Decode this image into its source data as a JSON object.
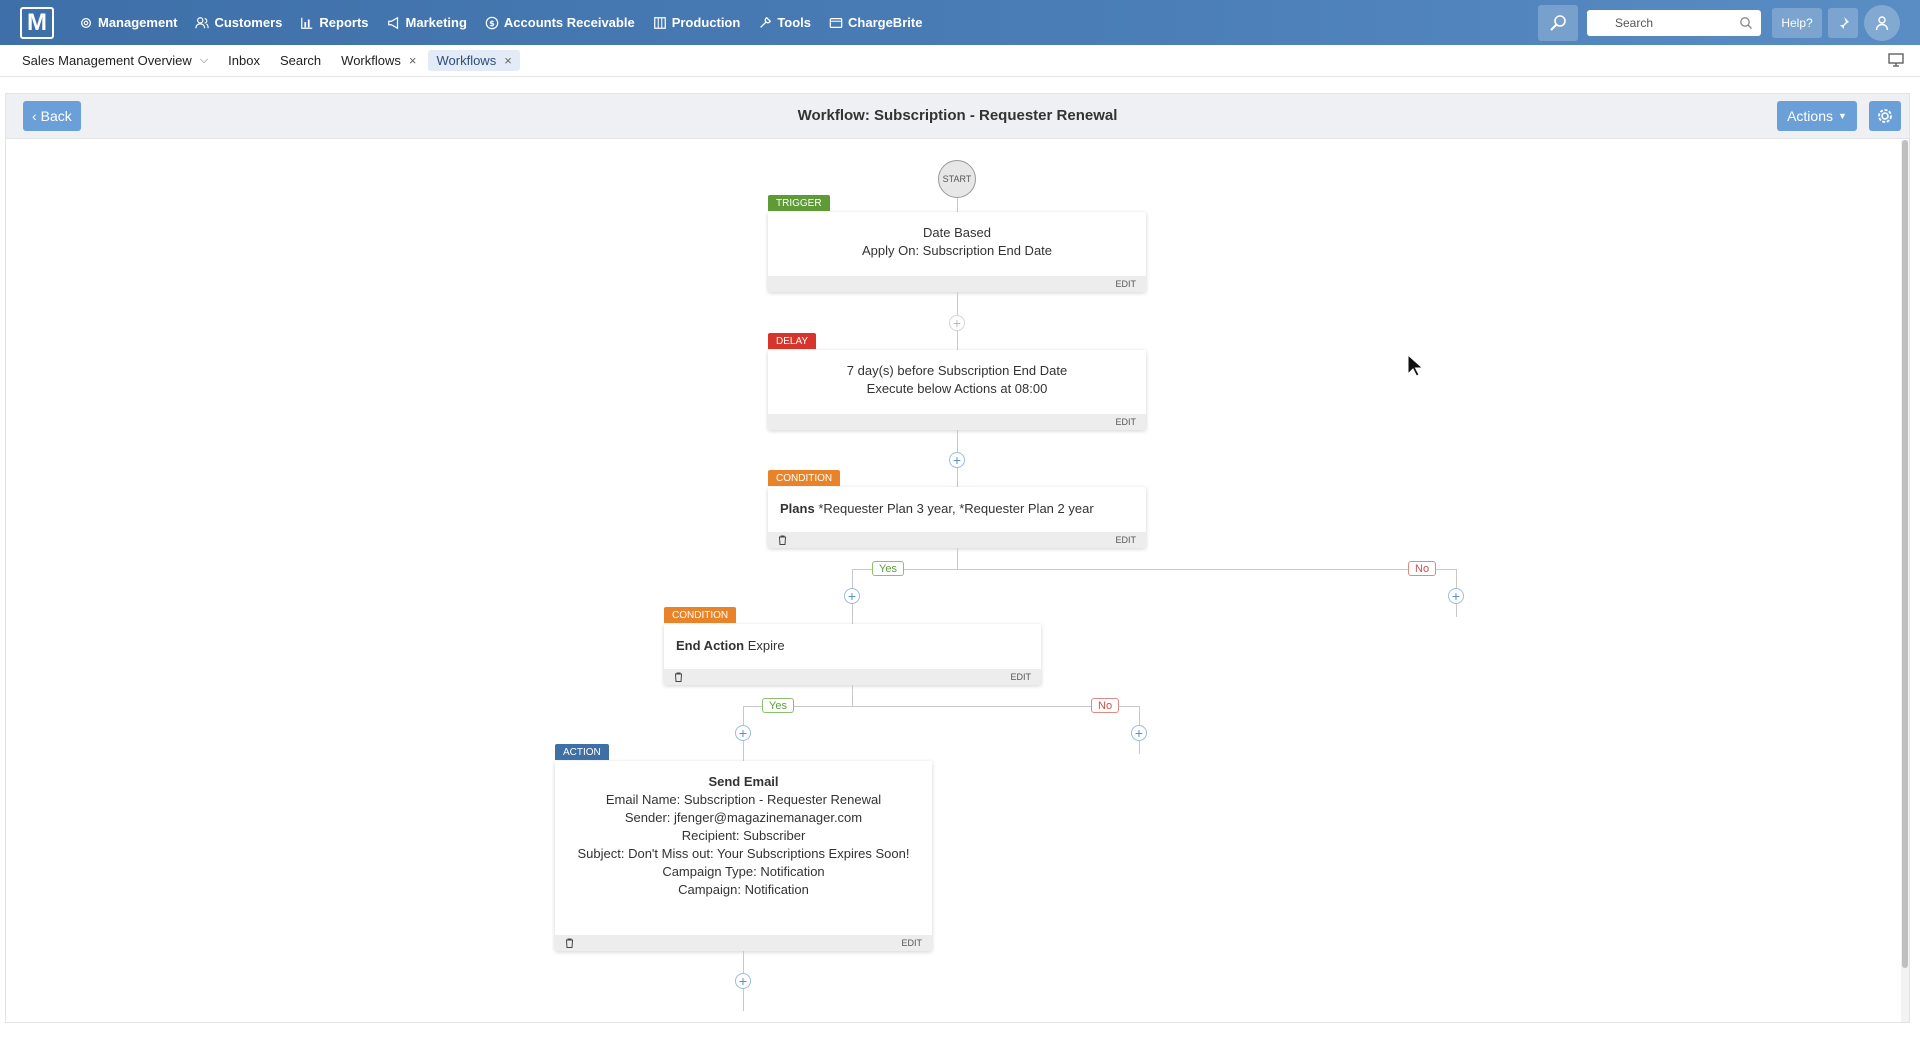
{
  "nav": {
    "logo": "M",
    "items": [
      {
        "label": "Management",
        "icon": "gear-icon"
      },
      {
        "label": "Customers",
        "icon": "users-icon"
      },
      {
        "label": "Reports",
        "icon": "bar-chart-icon"
      },
      {
        "label": "Marketing",
        "icon": "megaphone-icon"
      },
      {
        "label": "Accounts Receivable",
        "icon": "dollar-icon"
      },
      {
        "label": "Production",
        "icon": "columns-icon"
      },
      {
        "label": "Tools",
        "icon": "wrench-icon"
      },
      {
        "label": "ChargeBrite",
        "icon": "card-icon"
      }
    ],
    "search_placeholder": "Search",
    "help_label": "Help?"
  },
  "tabs": [
    {
      "label": "Sales Management Overview",
      "active": false
    },
    {
      "label": "Inbox",
      "active": false
    },
    {
      "label": "Search",
      "active": false
    },
    {
      "label": "Workflows",
      "active": false
    },
    {
      "label": "Workflows",
      "active": true
    }
  ],
  "header": {
    "back_label": "Back",
    "title": "Workflow: Subscription - Requester Renewal",
    "actions_label": "Actions"
  },
  "flow": {
    "start_label": "START",
    "trigger": {
      "tag": "TRIGGER",
      "line1": "Date Based",
      "line2": "Apply On: Subscription End Date",
      "edit": "EDIT"
    },
    "delay": {
      "tag": "DELAY",
      "line1": "7 day(s) before Subscription End Date",
      "line2": "Execute below Actions at 08:00",
      "edit": "EDIT"
    },
    "condition1": {
      "tag": "CONDITION",
      "key": "Plans",
      "value": "*Requester Plan 3 year, *Requester Plan 2 year",
      "edit": "EDIT"
    },
    "condition2": {
      "tag": "CONDITION",
      "key": "End Action",
      "value": "Expire",
      "edit": "EDIT"
    },
    "action": {
      "tag": "ACTION",
      "title": "Send Email",
      "lines": [
        "Email Name: Subscription - Requester Renewal",
        "Sender: jfenger@magazinemanager.com",
        "Recipient: Subscriber",
        "Subject: Don't Miss out: Your Subscriptions Expires Soon!",
        "Campaign Type: Notification",
        "Campaign: Notification"
      ],
      "edit": "EDIT"
    },
    "yes_label": "Yes",
    "no_label": "No"
  },
  "colors": {
    "trigger": "#5e9a35",
    "delay": "#d9342b",
    "condition": "#e8832a",
    "action": "#3f6fa5",
    "button": "#6a9fd8"
  }
}
